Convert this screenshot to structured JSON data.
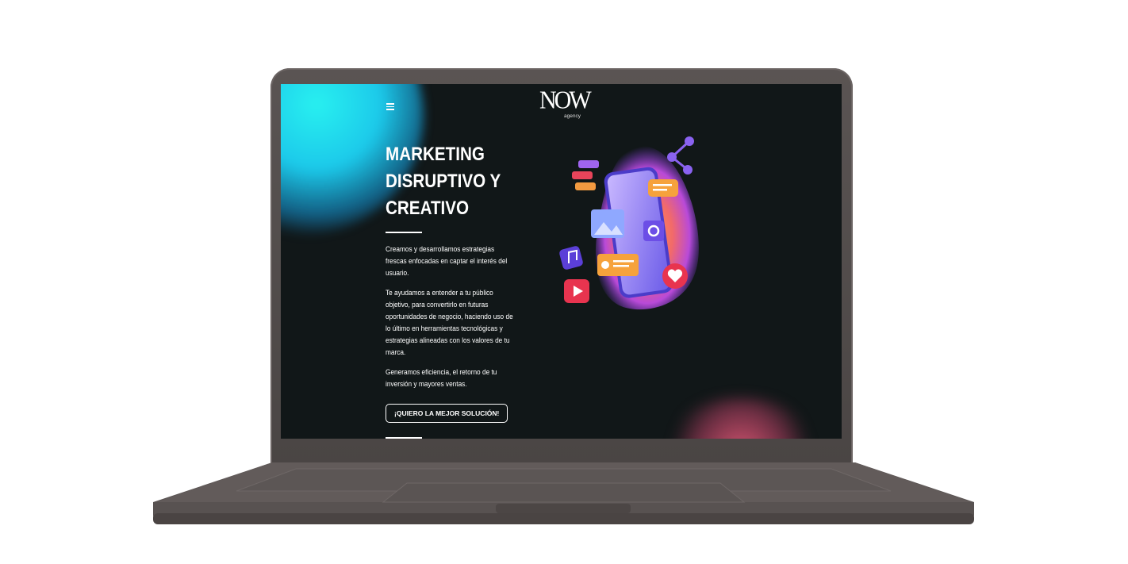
{
  "site": {
    "logo_text": "NOW",
    "logo_sub": "agency"
  },
  "hero": {
    "title_lines": [
      "MARKETING",
      "DISRUPTIVO Y",
      "CREATIVO"
    ],
    "paragraphs": [
      "Creamos y desarrollamos estrategias frescas enfocadas en captar el interés del usuario.",
      "Te ayudamos a entender a tu público objetivo, para convertirlo en futuras oportunidades de negocio, haciendo uso de lo último en herramientas tecnológicas y estrategias alineadas con los valores de tu marca.",
      "Generamos eficiencia, el retorno de tu inversión y mayores ventas."
    ],
    "cta_label": "¡QUIERO LA MEJOR SOLUCIÓN!"
  },
  "icons": {
    "menu": "hamburger-menu-icon",
    "illustration": "social-media-phone-illustration"
  },
  "colors": {
    "background": "#111718",
    "accent_cyan": "#1cc9ea",
    "accent_pink": "#e65a78",
    "laptop_body": "#544e4d"
  }
}
